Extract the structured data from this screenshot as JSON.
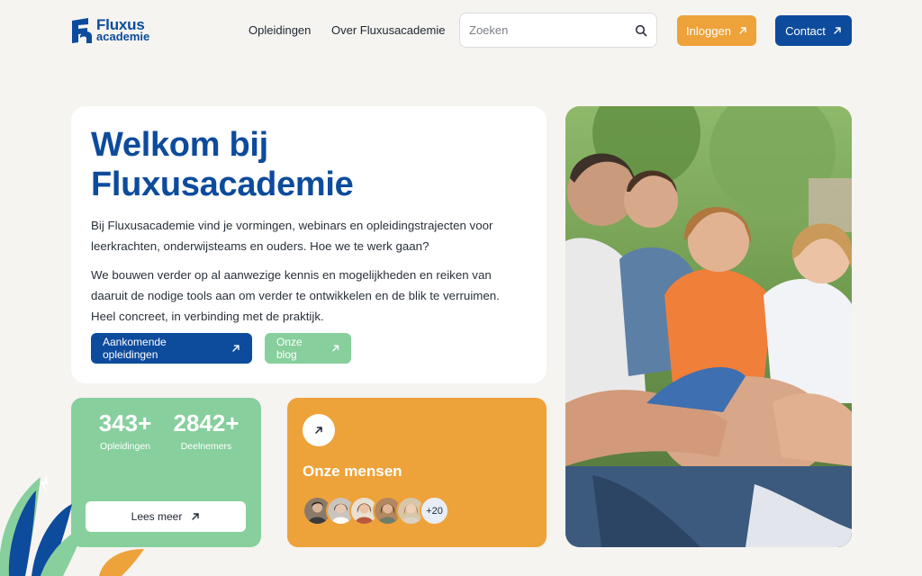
{
  "brand": {
    "line1": "Fluxus",
    "line2": "academie"
  },
  "nav": {
    "items": [
      "Opleidingen",
      "Over Fluxusacademie"
    ]
  },
  "search": {
    "placeholder": "Zoeken"
  },
  "header_buttons": {
    "login": "Inloggen",
    "contact": "Contact"
  },
  "hero": {
    "title": "Welkom bij Fluxusacademie",
    "paragraph1": "Bij Fluxusacademie vind je vormingen, webinars en opleidingstrajecten voor leerkrachten, onderwijsteams en ouders. Hoe we te werk gaan?",
    "paragraph2": "We bouwen verder op al aanwezige kennis en mogelijkheden en reiken van daaruit de nodige tools aan om verder te ontwikkelen en de blik te verruimen. Heel concreet, in verbinding met de praktijk.",
    "primary_button": "Aankomende opleidingen",
    "secondary_button": "Onze blog"
  },
  "stats": {
    "items": [
      {
        "value": "343+",
        "label": "Opleidingen"
      },
      {
        "value": "2842+",
        "label": "Deelnemers"
      }
    ],
    "button": "Lees meer"
  },
  "people": {
    "title": "Onze mensen",
    "more_count": "+20"
  },
  "colors": {
    "brand_blue": "#0d4b9c",
    "accent_orange": "#eea23a",
    "accent_green": "#87cf9d",
    "background": "#f5f4f0"
  },
  "icons": [
    "logo-mark",
    "search-icon",
    "arrow-up-right-icon"
  ]
}
